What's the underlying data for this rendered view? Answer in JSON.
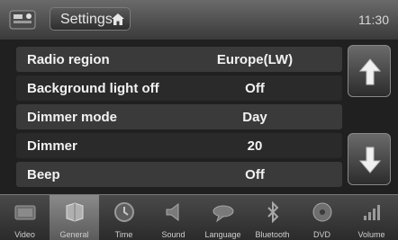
{
  "header": {
    "title": "Settings",
    "time": "11:30",
    "app_icon": "settings-app-icon",
    "home_icon": "home-icon"
  },
  "settings": [
    {
      "label": "Radio region",
      "value": "Europe(LW)"
    },
    {
      "label": "Background light off",
      "value": "Off"
    },
    {
      "label": "Dimmer mode",
      "value": "Day"
    },
    {
      "label": "Dimmer",
      "value": "20"
    },
    {
      "label": "Beep",
      "value": "Off"
    }
  ],
  "scroll": {
    "up_icon": "arrow-up-icon",
    "down_icon": "arrow-down-icon"
  },
  "tabs": [
    {
      "label": "Video",
      "icon": "video-icon",
      "active": false
    },
    {
      "label": "General",
      "icon": "general-icon",
      "active": true
    },
    {
      "label": "Time",
      "icon": "clock-icon",
      "active": false
    },
    {
      "label": "Sound",
      "icon": "speaker-icon",
      "active": false
    },
    {
      "label": "Language",
      "icon": "language-icon",
      "active": false
    },
    {
      "label": "Bluetooth",
      "icon": "bluetooth-icon",
      "active": false
    },
    {
      "label": "DVD",
      "icon": "disc-icon",
      "active": false
    },
    {
      "label": "Volume",
      "icon": "volume-icon",
      "active": false
    }
  ]
}
